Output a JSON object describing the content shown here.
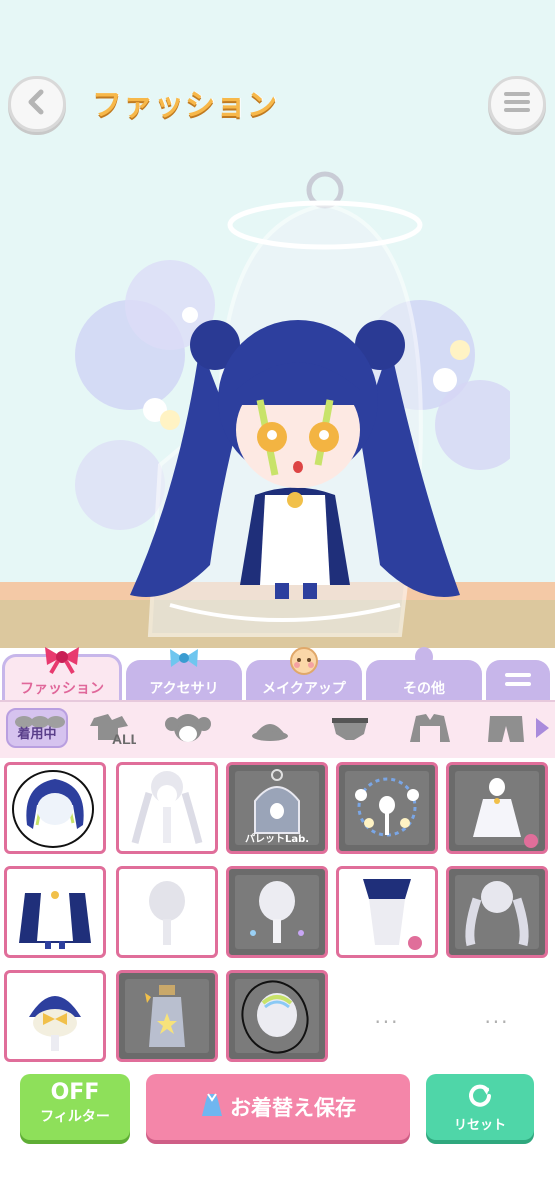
{
  "header": {
    "title": "ファッション",
    "back_icon": "chevron-left-icon",
    "menu_icon": "hamburger-icon"
  },
  "tabs": [
    {
      "label": "ファッション",
      "icon": "ribbon-icon",
      "active": true
    },
    {
      "label": "アクセサリ",
      "icon": "bow-icon",
      "active": false
    },
    {
      "label": "メイクアップ",
      "icon": "face-icon",
      "active": false
    },
    {
      "label": "その他",
      "icon": "mannequin-icon",
      "active": false
    },
    {
      "label": "",
      "icon": "menu-lines-icon",
      "active": false
    }
  ],
  "subcategory": {
    "worn_label": "着用中",
    "items": [
      "all-items-icon",
      "hair-icon",
      "hat-icon",
      "underwear-icon",
      "jacket-icon",
      "pants-icon"
    ]
  },
  "items": [
    {
      "name": "blue-hair-item",
      "dark": false,
      "caption": ""
    },
    {
      "name": "white-twintail-hair-item",
      "dark": false,
      "caption": ""
    },
    {
      "name": "palette-lab-cage-item",
      "dark": true,
      "caption": "パレットLab."
    },
    {
      "name": "flower-sparkle-effect-item",
      "dark": true,
      "caption": ""
    },
    {
      "name": "white-dress-item",
      "dark": true,
      "caption": ""
    },
    {
      "name": "navy-coat-dress-item",
      "dark": false,
      "caption": ""
    },
    {
      "name": "blank-mannequin-item",
      "dark": false,
      "caption": ""
    },
    {
      "name": "sparkle-mannequin-item",
      "dark": true,
      "caption": ""
    },
    {
      "name": "navy-skirt-item",
      "dark": false,
      "caption": ""
    },
    {
      "name": "white-long-hair-item",
      "dark": true,
      "caption": ""
    },
    {
      "name": "blue-hat-bow-item",
      "dark": false,
      "caption": ""
    },
    {
      "name": "star-bottle-item",
      "dark": true,
      "caption": ""
    },
    {
      "name": "green-highlight-hair-item",
      "dark": true,
      "caption": ""
    }
  ],
  "ellipsis": "...",
  "buttons": {
    "filter_big": "OFF",
    "filter_small": "フィルター",
    "save": "お着替え保存",
    "reset": "リセット"
  },
  "colors": {
    "accent_pink": "#e06e9a",
    "tab_purple": "#c7b6ea",
    "filter_green": "#8ee05a",
    "save_pink": "#f486a9",
    "reset_teal": "#4fd6a8"
  }
}
